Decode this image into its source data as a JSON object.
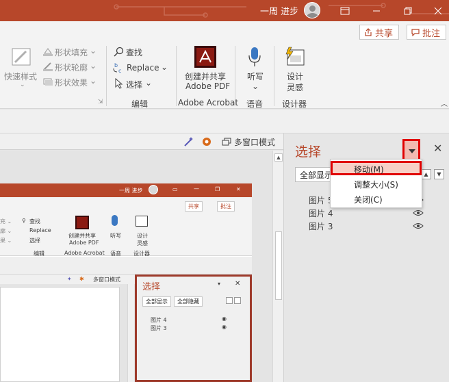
{
  "titlebar": {
    "user": "一周 进步",
    "icons": [
      "avatar-icon",
      "ribbon-display-icon",
      "minimize-icon",
      "restore-icon",
      "close-icon"
    ],
    "color": "#b7472a"
  },
  "ribbon": {
    "share": "共享",
    "comment": "批注",
    "quick_styles": "快速样式",
    "shape_fill": "形状填充",
    "shape_outline": "形状轮廓",
    "shape_effects": "形状效果",
    "find": "查找",
    "replace": "Replace",
    "select": "选择",
    "edit_group": "编辑",
    "create_pdf_line1": "创建并共享",
    "create_pdf_line2": "Adobe PDF",
    "acrobat_group": "Adobe Acrobat",
    "dictate": "听写",
    "voice_group": "语音",
    "designer_line1": "设计",
    "designer_line2": "灵感",
    "designer_group": "设计器"
  },
  "canvas_toolbar": {
    "multi_window": "多窗口模式"
  },
  "selection_pane": {
    "title": "选择",
    "show_all": "全部显示",
    "items": [
      "图片 5",
      "图片 4",
      "图片 3"
    ]
  },
  "context_menu": {
    "items": [
      "移动(M)",
      "调整大小(S)",
      "关闭(C)"
    ],
    "highlight_color": "#e00000"
  },
  "embedded_screenshot": {
    "user": "一周 进步",
    "share": "共享",
    "comment": "批注",
    "find": "查找",
    "replace": "Replace",
    "select": "选择",
    "edit_group": "编辑",
    "create_pdf_line1": "创建并共享",
    "create_pdf_line2": "Adobe PDF",
    "acrobat_group": "Adobe Acrobat",
    "dictate": "听写",
    "voice_group": "语音",
    "designer_line1": "设计",
    "designer_line2": "灵感",
    "designer_group": "设计器",
    "multi_window": "多窗口模式",
    "pane_title": "选择",
    "show_all": "全部显示",
    "hide_all": "全部隐藏",
    "items": [
      "图片 4",
      "图片 3"
    ]
  }
}
